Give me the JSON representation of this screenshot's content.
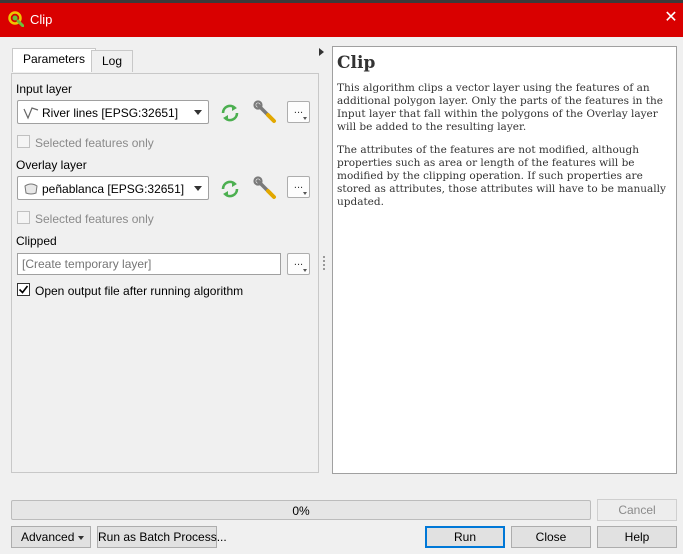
{
  "window": {
    "title": "Clip"
  },
  "tabs": [
    {
      "label": "Parameters",
      "active": true
    },
    {
      "label": "Log",
      "active": false
    }
  ],
  "params": {
    "input_layer": {
      "label": "Input layer",
      "value": "River lines [EPSG:32651]",
      "layer_icon": "line-layer-icon",
      "selected_only_label": "Selected features only",
      "selected_only_checked": false
    },
    "overlay_layer": {
      "label": "Overlay layer",
      "value": "peñablanca [EPSG:32651]",
      "layer_icon": "polygon-layer-icon",
      "selected_only_label": "Selected features only",
      "selected_only_checked": false
    },
    "clipped": {
      "label": "Clipped",
      "placeholder": "[Create temporary layer]",
      "open_output_label": "Open output file after running algorithm",
      "open_output_checked": true
    },
    "dots_label": "..."
  },
  "help": {
    "title": "Clip",
    "paragraphs": [
      "This algorithm clips a vector layer using the features of an additional polygon layer. Only the parts of the features in the Input layer that fall within the polygons of the Overlay layer will be added to the resulting layer.",
      "The attributes of the features are not modified, although properties such as area or length of the features will be modified by the clipping operation. If such properties are stored as attributes, those attributes will have to be manually updated."
    ]
  },
  "progress": {
    "value": 0,
    "text": "0%"
  },
  "buttons": {
    "cancel": "Cancel",
    "advanced": "Advanced",
    "batch": "Run as Batch Process...",
    "run": "Run",
    "close": "Close",
    "help": "Help"
  },
  "colors": {
    "titlebar": "#d90000",
    "iterate_icon": "#4caf50",
    "default_button_border": "#0078d7"
  }
}
